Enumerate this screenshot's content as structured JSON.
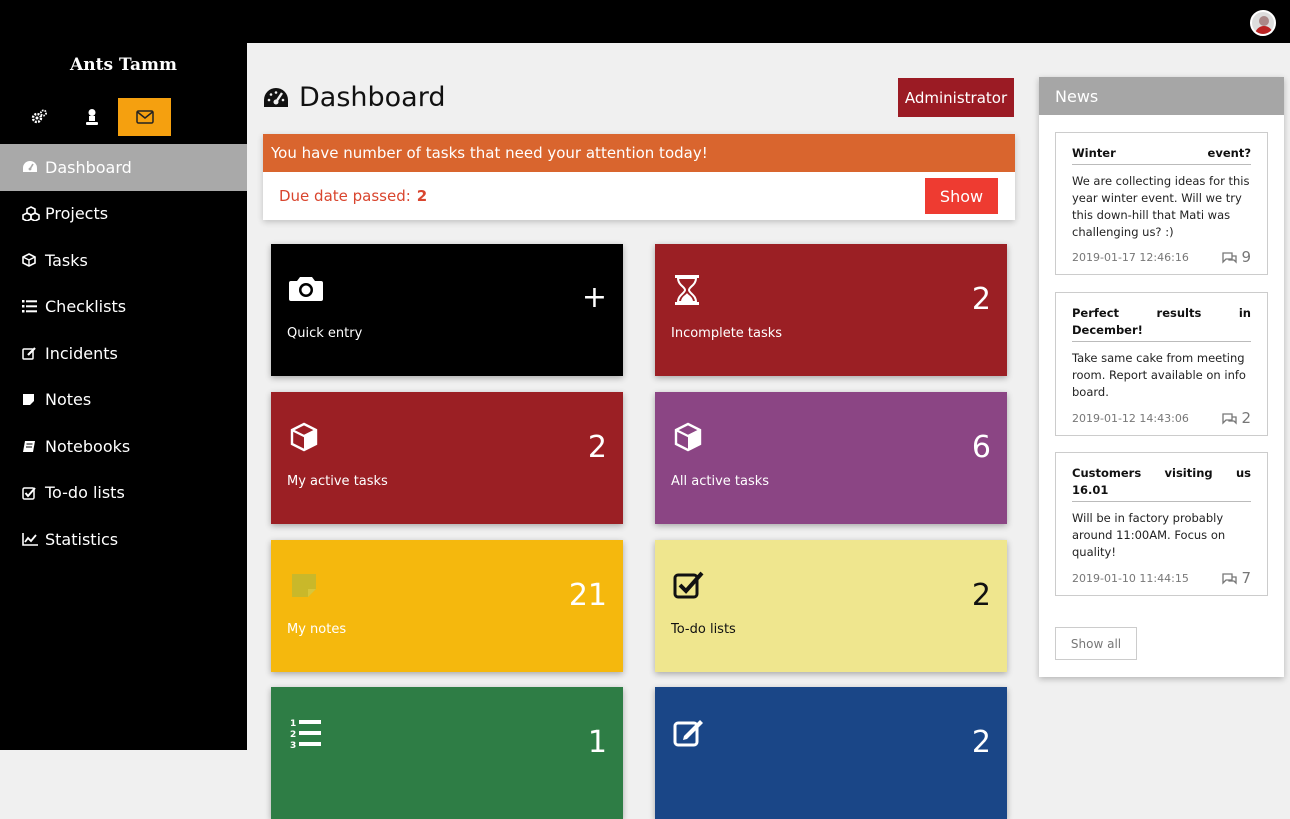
{
  "user": {
    "name": "Ants Tamm"
  },
  "sidebar": {
    "icons": [
      "gears-icon",
      "user-icon",
      "envelope-icon"
    ],
    "items": [
      {
        "label": "Dashboard",
        "icon": "dashboard-icon",
        "active": true
      },
      {
        "label": "Projects",
        "icon": "cubes-icon"
      },
      {
        "label": "Tasks",
        "icon": "cube-icon"
      },
      {
        "label": "Checklists",
        "icon": "list-icon"
      },
      {
        "label": "Incidents",
        "icon": "edit-icon"
      },
      {
        "label": "Notes",
        "icon": "sticky-note-icon"
      },
      {
        "label": "Notebooks",
        "icon": "book-icon"
      },
      {
        "label": "To-do lists",
        "icon": "check-square-icon"
      },
      {
        "label": "Statistics",
        "icon": "line-chart-icon"
      }
    ]
  },
  "page": {
    "title": "Dashboard",
    "role_button": "Administrator"
  },
  "alert": {
    "message": "You have number of tasks that need your attention today!",
    "due_label": "Due date passed:",
    "due_count": "2",
    "show_label": "Show",
    "colors": {
      "header": "#d9652e",
      "text": "#d9452e",
      "button": "#ee3b31"
    }
  },
  "tiles": [
    {
      "label": "Quick entry",
      "count": "+",
      "icon": "camera-icon",
      "color": "#000000"
    },
    {
      "label": "Incomplete tasks",
      "count": "2",
      "icon": "hourglass-icon",
      "color": "#9b1f24"
    },
    {
      "label": "My active tasks",
      "count": "2",
      "icon": "cube-icon",
      "color": "#9b1f24"
    },
    {
      "label": "All active tasks",
      "count": "6",
      "icon": "cube-icon",
      "color": "#8b4584"
    },
    {
      "label": "My notes",
      "count": "21",
      "icon": "sticky-note-icon",
      "color": "#f5b80d"
    },
    {
      "label": "To-do lists",
      "count": "2",
      "icon": "check-square-icon",
      "color": "#efe68e"
    },
    {
      "label": "",
      "count": "1",
      "icon": "ordered-list-icon",
      "color": "#2e7d45"
    },
    {
      "label": "",
      "count": "2",
      "icon": "edit-icon",
      "color": "#1a4687"
    }
  ],
  "news": {
    "title": "News",
    "items": [
      {
        "title": "Winter event?",
        "text": "We are collecting ideas for this year winter event. Will we try this down-hill that Mati was challenging us? :)",
        "date": "2019-01-17 12:46:16",
        "comments": "9"
      },
      {
        "title": "Perfect results in December!",
        "text": "Take same cake from meeting room. Report available on info board.",
        "date": "2019-01-12 14:43:06",
        "comments": "2"
      },
      {
        "title": "Customers visiting us 16.01",
        "text": "Will be in factory probably around 11:00AM. Focus on quality!",
        "date": "2019-01-10 11:44:15",
        "comments": "7"
      }
    ],
    "show_all": "Show all"
  }
}
